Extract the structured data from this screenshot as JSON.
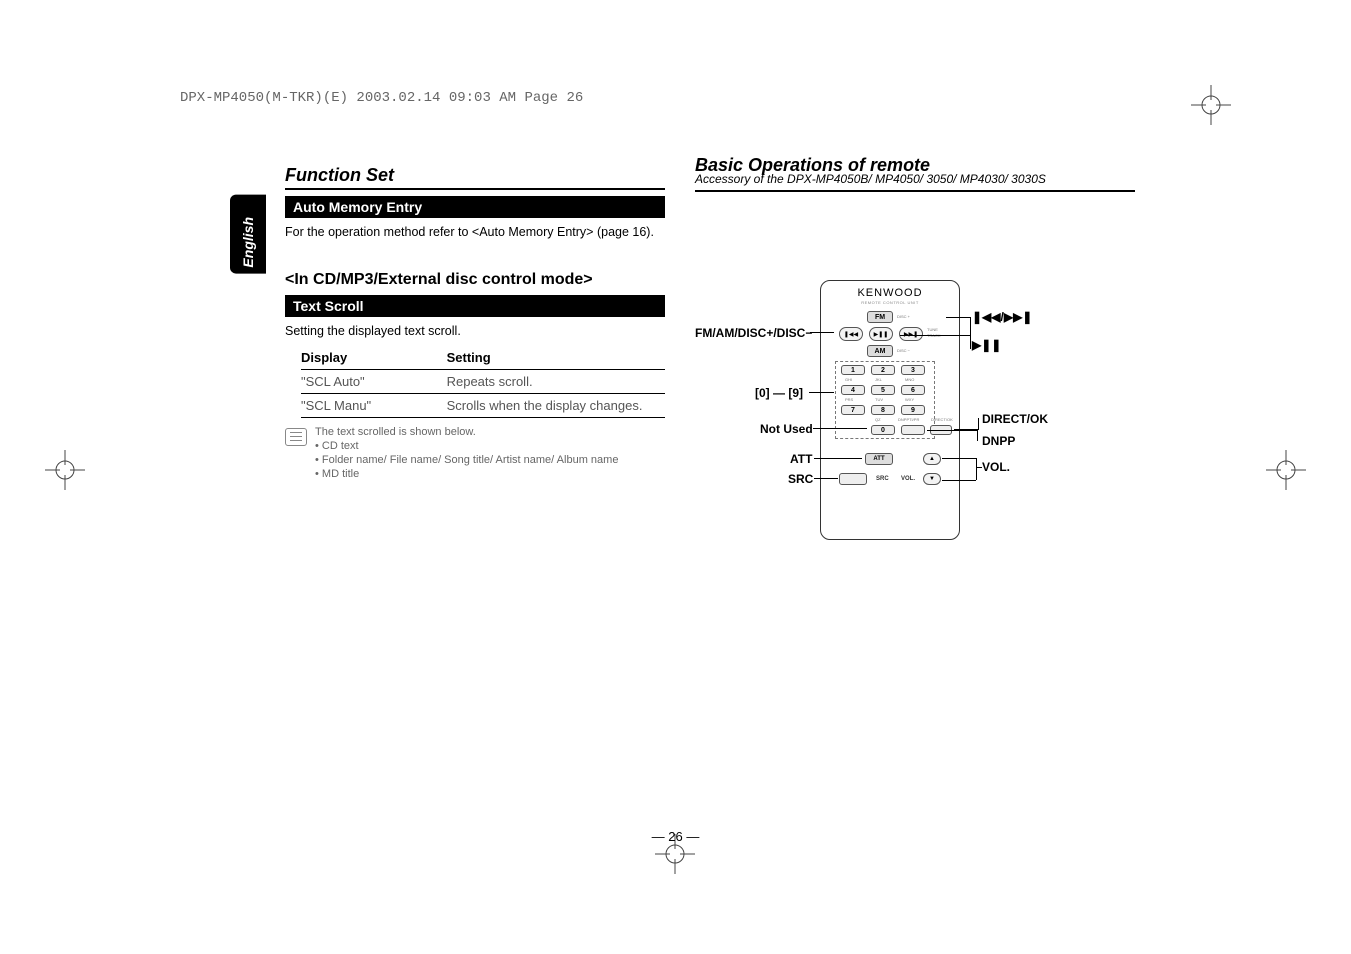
{
  "print_header": "DPX-MP4050(M-TKR)(E)  2003.02.14  09:03 AM  Page 26",
  "lang_tab": "English",
  "page_number": "— 26 —",
  "left": {
    "title": "Function Set",
    "bar1": "Auto Memory Entry",
    "body1": "For the operation method refer to <Auto Memory Entry> (page 16).",
    "sub": "<In CD/MP3/External disc control mode>",
    "bar2": "Text Scroll",
    "body2": "Setting the displayed text scroll.",
    "table": {
      "h1": "Display",
      "h2": "Setting",
      "rows": [
        {
          "c1": "\"SCL Auto\"",
          "c2": "Repeats scroll."
        },
        {
          "c1": "\"SCL Manu\"",
          "c2": "Scrolls when the display changes."
        }
      ]
    },
    "note": {
      "l1": "The text scrolled is shown below.",
      "l2": "• CD text",
      "l3": "• Folder name/ File name/ Song title/ Artist name/ Album name",
      "l4": "• MD title"
    }
  },
  "right": {
    "title": "Basic Operations of remote",
    "subtitle": "Accessory of the DPX-MP4050B/ MP4050/ 3050/ MP4030/ 3030S"
  },
  "remote": {
    "brand": "KENWOOD",
    "sub": "REMOTE CONTROL UNIT",
    "fm": "FM",
    "am": "AM",
    "prev": "❚◀◀",
    "play": "▶❚❚",
    "next": "▶▶❚",
    "tune": "TUNE",
    "track": "TRACK",
    "disc_plus": "DISC +",
    "disc_minus": "DISC −",
    "n1": "1",
    "n2": "2",
    "n3": "3",
    "n4": "4",
    "n5": "5",
    "n6": "6",
    "n7": "7",
    "n8": "8",
    "n9": "9",
    "n0": "0",
    "ghi": "GHI",
    "jkl": "JKL",
    "mno": "MNO",
    "pqr": "PRS",
    "tuv": "TUV",
    "wxy": "WXY",
    "qz": "QZ",
    "dnpp": "DNPPTI/PR",
    "direct": "DIRECT/OK",
    "att": "ATT",
    "src": "SRC",
    "vol": "VOL.",
    "up": "▲",
    "down": "▼"
  },
  "labels": {
    "fm": "FM/AM/DISC+/DISC−",
    "tune_sym": "❚◀◀/▶▶❚",
    "play_sym": "▶❚❚",
    "nums": "[0] — [9]",
    "notused": "Not Used",
    "att": "ATT",
    "src": "SRC",
    "direct": "DIRECT/OK",
    "dnpp": "DNPP",
    "vol": "VOL."
  }
}
